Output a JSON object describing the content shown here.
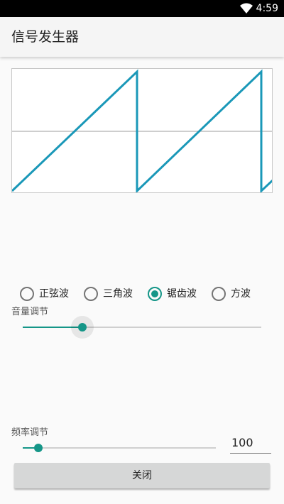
{
  "status_bar": {
    "time": "4:59",
    "wifi_icon": "wifi-icon"
  },
  "app": {
    "title": "信号发生器"
  },
  "waveform": {
    "type": "sawtooth",
    "color": "#1a98b8",
    "axis_color": "#bdbdbd"
  },
  "wave_options": [
    {
      "label": "正弦波",
      "checked": false
    },
    {
      "label": "三角波",
      "checked": false
    },
    {
      "label": "锯齿波",
      "checked": true
    },
    {
      "label": "方波",
      "checked": false
    }
  ],
  "volume": {
    "label": "音量调节",
    "value_fraction": 0.25
  },
  "frequency": {
    "label": "频率调节",
    "value": "100",
    "value_fraction": 0.08
  },
  "close_button": {
    "label": "关闭"
  },
  "colors": {
    "accent": "#159688",
    "button": "#d6d7d7"
  }
}
